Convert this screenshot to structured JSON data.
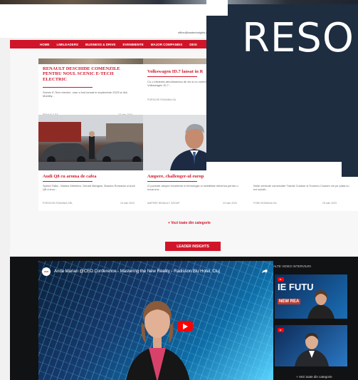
{
  "site": {
    "contact": "office@leaderinsights.ro",
    "nav": [
      "HOME",
      "LIMILEADERS",
      "BUSINESS & DRIVE",
      "EVENIMENTE",
      "MAJOR COMPANIES",
      "DESI"
    ]
  },
  "cards": [
    {
      "title": "RENAULT DESCHIDE COMENZILE PENTRU NOUL SCENIC E-TECH ELECTRIC",
      "excerpt": "Scenic E-Tech electric, care a fost lansat in septembrie 2023 la IAA Mobility...",
      "author": "RENAULT SA",
      "date": "15 iulie 2024"
    },
    {
      "title": "Volkswagen ID.7 lansat in R",
      "excerpt": "Cu o eficienta aerodinamica de vis si un confort electric, Volkswagen ID.7...",
      "author": "PORSCHE ROMANIA SA"
    },
    {
      "title": "Audi Q8 cu aroma de cafea",
      "excerpt": "Speed Talks - Marius Mehelea, Gerald Mangesi, Bosses Romania si Audi Q8 e-tron...",
      "author": "PORSCHE ROMANIA SRL",
      "date": "19 iulie 2023"
    },
    {
      "title": "Ampere, challenger-ul europ",
      "excerpt": "O poveste despre excelenta in tehnologie si mobilitate electrica pentru o noua era...",
      "author": "AMPERE RENAULT GROUP",
      "date": "23 iulie 2023"
    },
    {
      "excerpt": "Noile vehicule comerciale Transit Custom si Tourneo Custom vin pe piata cu noi solutii...",
      "author": "FORD ROMANIA SA",
      "date": "25 iulie 2023"
    }
  ],
  "see_all_label": "+ Vezi toate din categorie",
  "cta_label": "LEADER INSIGHTS",
  "video": {
    "title": "Anda Marian @CEO Conference - Mastering the New Reality - Radisson Blu Hotel, Cluj",
    "channel": "CEO",
    "sidebar_title": "ALTE VIDEO INTERVIURI",
    "thumb1_text": "IE FUTU",
    "thumb1_sub": "NEW REA",
    "more_label": "+ Vezi toate din categorie"
  },
  "overlay": {
    "word": "RESO"
  },
  "colors": {
    "brand_red": "#d0152a",
    "overlay_navy": "#1e2d40",
    "video_band": "#111214"
  }
}
